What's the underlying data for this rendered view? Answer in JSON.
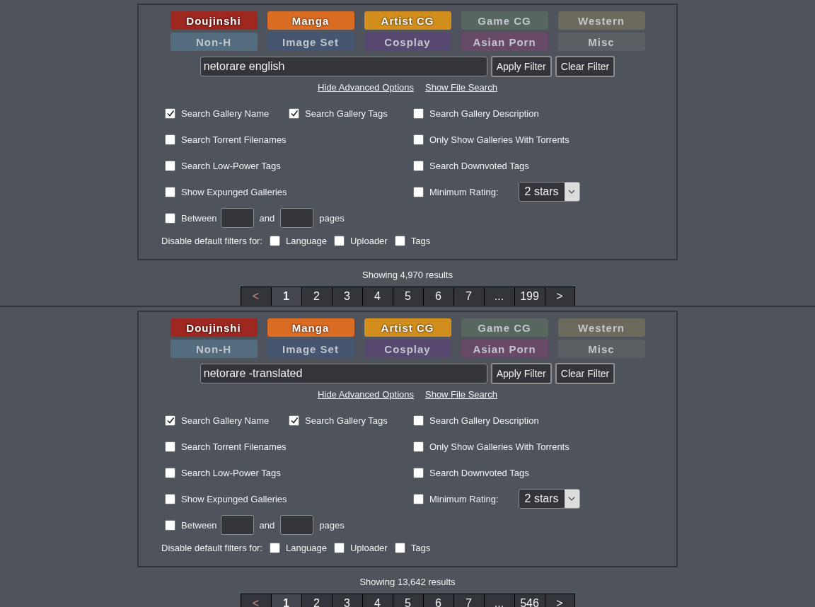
{
  "searches": [
    {
      "categories": [
        {
          "label": "Doujinshi",
          "color": "#9e2720",
          "on": true
        },
        {
          "label": "Manga",
          "color": "#db6c24",
          "on": true
        },
        {
          "label": "Artist CG",
          "color": "#d38f1d",
          "on": true
        },
        {
          "label": "Game CG",
          "color": "#57665f",
          "on": false
        },
        {
          "label": "Western",
          "color": "#6b6a5c",
          "on": false
        },
        {
          "label": "Non-H",
          "color": "#546d7e",
          "on": false
        },
        {
          "label": "Image Set",
          "color": "#465670",
          "on": false
        },
        {
          "label": "Cosplay",
          "color": "#574970",
          "on": false
        },
        {
          "label": "Asian Porn",
          "color": "#684967",
          "on": false
        },
        {
          "label": "Misc",
          "color": "#5b5e63",
          "on": false
        }
      ],
      "search": {
        "value": "netorare english"
      },
      "buttons": [
        "Apply Filter",
        "Clear Filter"
      ],
      "links": [
        "Hide Advanced Options",
        "Show File Search"
      ],
      "option_rows": [
        {
          "cells": [
            {
              "kind": "checkbox",
              "label": "Search Gallery Name",
              "checked": true
            },
            {
              "kind": "checkbox",
              "label": "Search Gallery Tags",
              "checked": true
            },
            {
              "kind": "checkbox",
              "label": "Search Gallery Description",
              "checked": false
            }
          ]
        },
        {
          "cells": [
            {
              "kind": "checkbox",
              "label": "Search Torrent Filenames",
              "checked": false
            },
            {
              "kind": "checkbox",
              "label": "Only Show Galleries With Torrents",
              "checked": false
            }
          ]
        },
        {
          "cells": [
            {
              "kind": "checkbox",
              "label": "Search Low-Power Tags",
              "checked": false
            },
            {
              "kind": "checkbox",
              "label": "Search Downvoted Tags",
              "checked": false
            }
          ]
        },
        {
          "cells": [
            {
              "kind": "checkbox",
              "label": "Show Expunged Galleries",
              "checked": false
            },
            {
              "kind": "rating",
              "label": "Minimum Rating:",
              "checked": false,
              "value": "2 stars"
            }
          ]
        },
        {
          "cells": [
            {
              "kind": "range",
              "label": "Between",
              "middle": "and",
              "suffix": "pages",
              "checked": false
            }
          ]
        }
      ],
      "default_filters": {
        "label": "Disable default filters for:",
        "items": [
          {
            "label": "Language",
            "checked": false
          },
          {
            "label": "Uploader",
            "checked": false
          },
          {
            "label": "Tags",
            "checked": false
          }
        ]
      },
      "results": "Showing 4,970 results",
      "pages": [
        {
          "label": "<",
          "selected": false,
          "disabled": true
        },
        {
          "label": "1",
          "selected": true,
          "disabled": false
        },
        {
          "label": "2",
          "selected": false,
          "disabled": false
        },
        {
          "label": "3",
          "selected": false,
          "disabled": false
        },
        {
          "label": "4",
          "selected": false,
          "disabled": false
        },
        {
          "label": "5",
          "selected": false,
          "disabled": false
        },
        {
          "label": "6",
          "selected": false,
          "disabled": false
        },
        {
          "label": "7",
          "selected": false,
          "disabled": false
        },
        {
          "label": "...",
          "selected": false,
          "disabled": false
        },
        {
          "label": "199",
          "selected": false,
          "disabled": false
        },
        {
          "label": ">",
          "selected": false,
          "disabled": false
        }
      ]
    },
    {
      "categories": [
        {
          "label": "Doujinshi",
          "color": "#9e2720",
          "on": true
        },
        {
          "label": "Manga",
          "color": "#db6c24",
          "on": true
        },
        {
          "label": "Artist CG",
          "color": "#d38f1d",
          "on": true
        },
        {
          "label": "Game CG",
          "color": "#57665f",
          "on": false
        },
        {
          "label": "Western",
          "color": "#6b6a5c",
          "on": false
        },
        {
          "label": "Non-H",
          "color": "#546d7e",
          "on": false
        },
        {
          "label": "Image Set",
          "color": "#465670",
          "on": false
        },
        {
          "label": "Cosplay",
          "color": "#574970",
          "on": false
        },
        {
          "label": "Asian Porn",
          "color": "#684967",
          "on": false
        },
        {
          "label": "Misc",
          "color": "#5b5e63",
          "on": false
        }
      ],
      "search": {
        "value": "netorare -translated"
      },
      "buttons": [
        "Apply Filter",
        "Clear Filter"
      ],
      "links": [
        "Hide Advanced Options",
        "Show File Search"
      ],
      "option_rows": [
        {
          "cells": [
            {
              "kind": "checkbox",
              "label": "Search Gallery Name",
              "checked": true
            },
            {
              "kind": "checkbox",
              "label": "Search Gallery Tags",
              "checked": true
            },
            {
              "kind": "checkbox",
              "label": "Search Gallery Description",
              "checked": false
            }
          ]
        },
        {
          "cells": [
            {
              "kind": "checkbox",
              "label": "Search Torrent Filenames",
              "checked": false
            },
            {
              "kind": "checkbox",
              "label": "Only Show Galleries With Torrents",
              "checked": false
            }
          ]
        },
        {
          "cells": [
            {
              "kind": "checkbox",
              "label": "Search Low-Power Tags",
              "checked": false
            },
            {
              "kind": "checkbox",
              "label": "Search Downvoted Tags",
              "checked": false
            }
          ]
        },
        {
          "cells": [
            {
              "kind": "checkbox",
              "label": "Show Expunged Galleries",
              "checked": false
            },
            {
              "kind": "rating",
              "label": "Minimum Rating:",
              "checked": false,
              "value": "2 stars"
            }
          ]
        },
        {
          "cells": [
            {
              "kind": "range",
              "label": "Between",
              "middle": "and",
              "suffix": "pages",
              "checked": false
            }
          ]
        }
      ],
      "default_filters": {
        "label": "Disable default filters for:",
        "items": [
          {
            "label": "Language",
            "checked": false
          },
          {
            "label": "Uploader",
            "checked": false
          },
          {
            "label": "Tags",
            "checked": false
          }
        ]
      },
      "results": "Showing 13,642 results",
      "pages": [
        {
          "label": "<",
          "selected": false,
          "disabled": true
        },
        {
          "label": "1",
          "selected": true,
          "disabled": false
        },
        {
          "label": "2",
          "selected": false,
          "disabled": false
        },
        {
          "label": "3",
          "selected": false,
          "disabled": false
        },
        {
          "label": "4",
          "selected": false,
          "disabled": false
        },
        {
          "label": "5",
          "selected": false,
          "disabled": false
        },
        {
          "label": "6",
          "selected": false,
          "disabled": false
        },
        {
          "label": "7",
          "selected": false,
          "disabled": false
        },
        {
          "label": "...",
          "selected": false,
          "disabled": false
        },
        {
          "label": "546",
          "selected": false,
          "disabled": false
        },
        {
          "label": ">",
          "selected": false,
          "disabled": false
        }
      ]
    }
  ]
}
